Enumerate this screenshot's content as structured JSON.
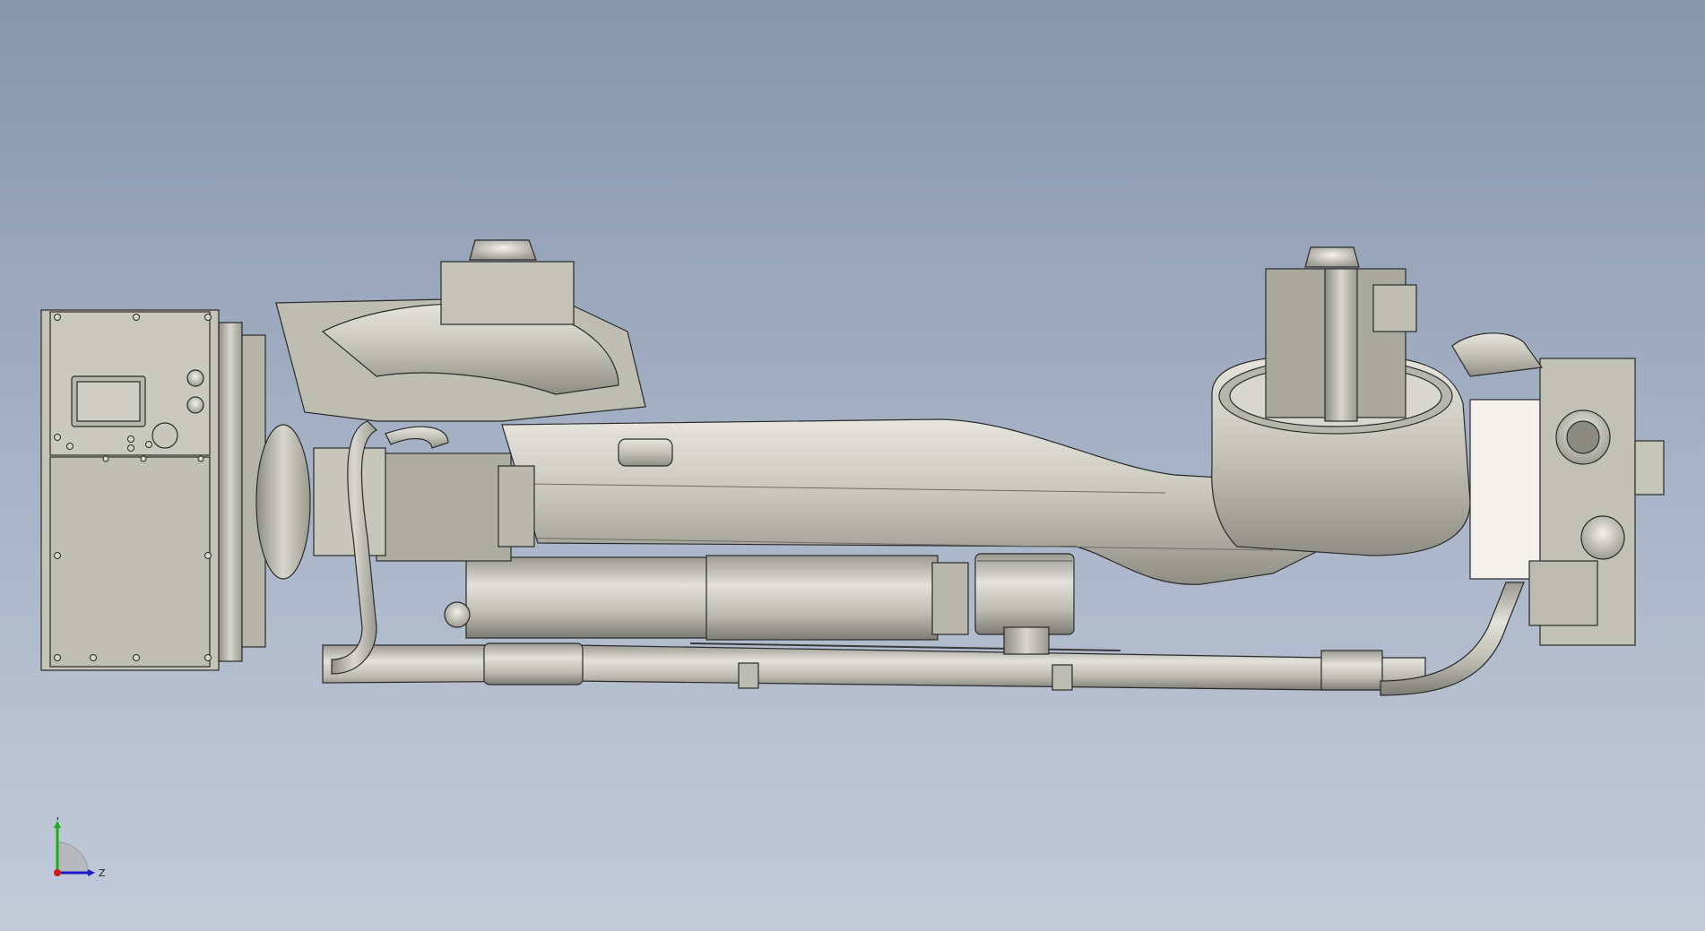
{
  "viewport": {
    "background_top": "#8796ad",
    "background_bottom": "#c3cbd9"
  },
  "model": {
    "shell_color": "#c9c8bd",
    "edge_color": "#2a2a2a",
    "shadow_color": "#8e8d84",
    "highlight_color": "#ecebe4"
  },
  "triad": {
    "y_label": "Y",
    "z_label": "Z",
    "y_color": "#19b019",
    "z_color": "#1c1ccc",
    "x_color": "#d01c1c"
  }
}
